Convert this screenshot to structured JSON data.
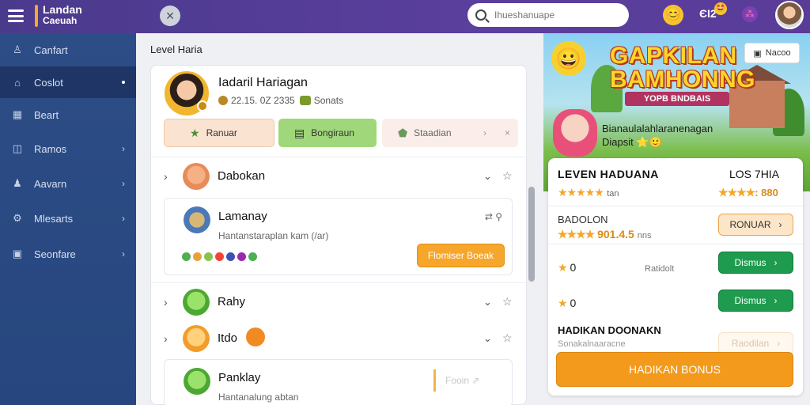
{
  "app": {
    "logo_line1": "Landan",
    "logo_line2": "Caeuah",
    "close_icon": "×"
  },
  "search": {
    "placeholder": "Ihueshanuape"
  },
  "topbar": {
    "points": "ЄI2",
    "badge": "🤩",
    "emoji": "😊",
    "notify": "⁂"
  },
  "sidebar": {
    "items": [
      {
        "label": "Canfart",
        "icon": "user-icon"
      },
      {
        "label": "Coslot",
        "icon": "home-icon"
      },
      {
        "label": "Beart",
        "icon": "grid-icon"
      },
      {
        "label": "Ramos",
        "icon": "chart-icon"
      },
      {
        "label": "Aavarn",
        "icon": "person-icon"
      },
      {
        "label": "Mlesarts",
        "icon": "settings-icon"
      },
      {
        "label": "Seonfare",
        "icon": "card-icon"
      }
    ]
  },
  "main": {
    "title": "Level Haria",
    "profile": {
      "name": "Iadaril Hariagan",
      "points": "22.15. 0Z 2335",
      "status": "Sonats"
    },
    "tabs": [
      {
        "label": "Ranuar"
      },
      {
        "label": "Bongiraun"
      },
      {
        "label": "Staadian"
      }
    ],
    "rows": [
      {
        "name": "Dabokan"
      },
      {
        "name": "Rahy"
      },
      {
        "name": "Itdo"
      }
    ],
    "card1": {
      "name": "Lamanay",
      "subtitle": "Hantanstaraplan kam (/ar)",
      "button": "Flomiser Boeak",
      "icons": "⇄ ⚲"
    },
    "card2": {
      "name": "Panklay",
      "subtitle": "Hantanalung abtan",
      "button": "Fooin ⇗"
    }
  },
  "banner": {
    "title_line1": "GAPKILAN",
    "title_line2": "BAMHONNG",
    "ribbon": "YOPB BNDBAIS",
    "sub_line1": "Bianaulalahlaranenagan",
    "sub_line2": "Diapsit ⭐🙂",
    "button": "Nacoo"
  },
  "leaderboard": {
    "title": "LEVEN HADUANA",
    "title_right": "LOS 7HIA",
    "row1_stars": "★★★★★",
    "row1_text": "tan",
    "row1_right_stars": "★★★★",
    "row1_right_value": ": 880",
    "row2_label": "BADOLON",
    "row2_stars": "★★★★",
    "row2_value": "901.4.5",
    "row2_unit": "nns",
    "row2_button": "RONUAR",
    "row3_value": "0",
    "row3_text": "Ratidolt",
    "row3_button": "Dismus",
    "row4_value": "0",
    "row4_button": "Dismus",
    "row5_label": "HADIKAN DOONAKN",
    "row5_sub": "Sonakalnaaracne",
    "row5_button": "Raodilan",
    "bonus_button": "HADIKAN BONUS"
  }
}
